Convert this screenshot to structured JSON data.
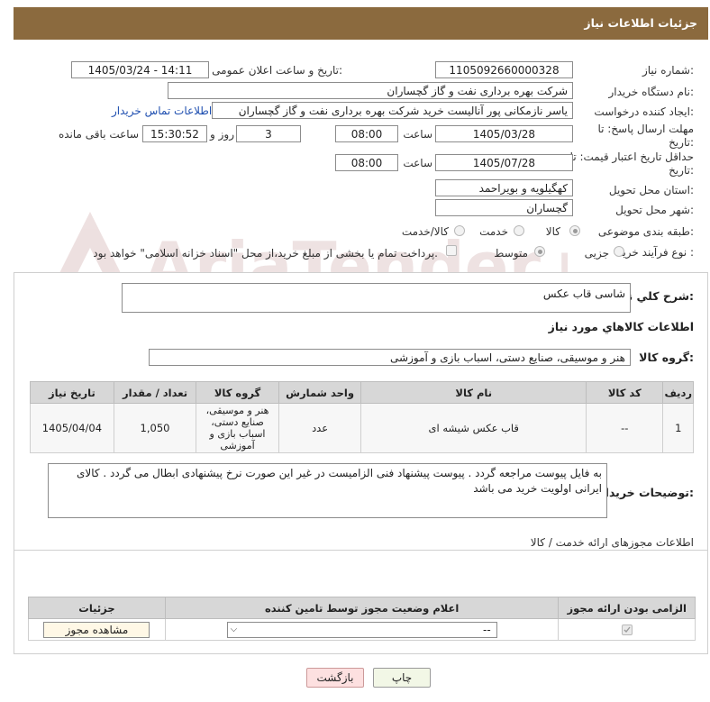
{
  "header": {
    "title": "جزئیات اطلاعات نیاز",
    "bg": "#8b6a3e"
  },
  "watermark": {
    "text": "AriaTender.net"
  },
  "form": {
    "need_number_label": "شماره نیاز:",
    "need_number": "1105092660000328",
    "announce_label": "تاریخ و ساعت اعلان عمومی:",
    "announce_value": "1405/03/24 - 14:11",
    "buyer_label": "نام دستگاه خریدار:",
    "buyer_value": "شرکت بهره برداری نفت و گاز گچساران",
    "creator_label": "ایجاد کننده درخواست:",
    "creator_value": "یاسر نازمکانی پور آنالیست خرید شرکت بهره برداری نفت و گاز گچساران",
    "contact_link": "اطلاعات تماس خریدار",
    "reply_deadline_label": "مهلت ارسال پاسخ: تا تاریخ:",
    "reply_date": "1405/03/28",
    "time_label": "ساعت",
    "reply_time": "08:00",
    "days_value": "3",
    "days_label": "روز و",
    "remaining_time": "15:30:52",
    "remaining_label": "ساعت باقی مانده",
    "min_price_label": "حداقل تاریخ اعتبار قیمت: تا تاریخ:",
    "price_date": "1405/07/28",
    "price_time": "08:00",
    "province_label": "استان محل تحویل:",
    "province_value": "کهگیلویه و بویراحمد",
    "city_label": "شهر محل تحویل:",
    "city_value": "گچساران",
    "category_label": "طبقه بندی موضوعی:",
    "category_options": [
      "کالا",
      "خدمت",
      "کالا/خدمت"
    ],
    "category_selected": "کالا",
    "process_label": "نوع فرآیند خرید :",
    "process_options": [
      "جزیی",
      "متوسط"
    ],
    "process_selected": "متوسط",
    "payment_note": "پرداخت تمام یا بخشی از مبلغ خرید،از محل \"اسناد خزانه اسلامی\" خواهد بود."
  },
  "description": {
    "label": "شرح کلي نياز:",
    "value": "شاسی قاب عکس"
  },
  "goods": {
    "section_title": "اطلاعات کالاهاي مورد نياز",
    "group_label": "گروه کالا:",
    "group_value": "هنر و موسیقی، صنایع دستی، اسباب بازی و آموزشی",
    "columns": [
      "ردیف",
      "کد کالا",
      "نام کالا",
      "واحد شمارش",
      "گروه کالا",
      "تعداد / مقدار",
      "تاریخ نیاز"
    ],
    "rows": [
      {
        "row": "1",
        "code": "--",
        "name": "قاب عکس شیشه ای",
        "unit": "عدد",
        "group": "هنر و موسیقی، صنایع دستی، اسباب بازی و آموزشی",
        "qty": "1,050",
        "date": "1405/04/04"
      }
    ]
  },
  "buyer_notes": {
    "label": "توضیحات خریدار:",
    "value": "به فایل پیوست مراجعه گردد . پیوست پیشنهاد فنی الزامیست در غیر این صورت نرخ پیشنهادی ابطال می گردد . کالای ایرانی اولویت خرید می باشد"
  },
  "permits": {
    "title": "اطلاعات مجوزهای ارائه خدمت / کالا",
    "columns": [
      "الزامی بودن ارائه مجوز",
      "اعلام وضعیت مجوز توسط تامین کننده",
      "جزئیات"
    ],
    "select_value": "--",
    "view_button": "مشاهده مجوز"
  },
  "footer": {
    "print_button": "چاپ",
    "back_button": "بازگشت"
  }
}
